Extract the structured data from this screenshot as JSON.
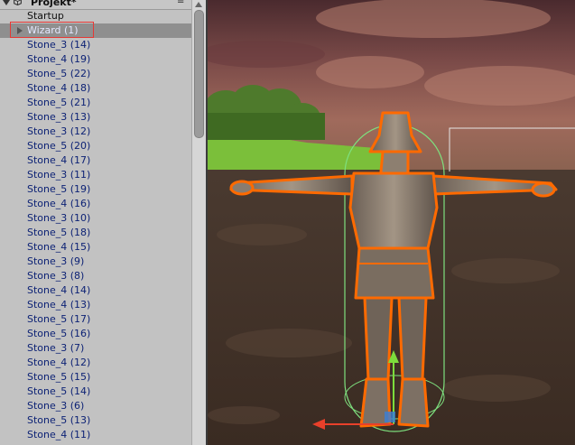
{
  "hierarchy": {
    "title": "Projekt*",
    "icons": {
      "collapse": "triangle-down-icon",
      "scene": "unity-scene-icon",
      "menu": "menu-icon"
    },
    "items": [
      {
        "label": "Startup",
        "style": "plain",
        "foldout": false
      },
      {
        "label": "Wizard (1)",
        "style": "selected",
        "foldout": true
      },
      {
        "label": "Stone_3 (14)"
      },
      {
        "label": "Stone_4 (19)"
      },
      {
        "label": "Stone_5 (22)"
      },
      {
        "label": "Stone_4 (18)"
      },
      {
        "label": "Stone_5 (21)"
      },
      {
        "label": "Stone_3 (13)"
      },
      {
        "label": "Stone_3 (12)"
      },
      {
        "label": "Stone_5 (20)"
      },
      {
        "label": "Stone_4 (17)"
      },
      {
        "label": "Stone_3 (11)"
      },
      {
        "label": "Stone_5 (19)"
      },
      {
        "label": "Stone_4 (16)"
      },
      {
        "label": "Stone_3 (10)"
      },
      {
        "label": "Stone_5 (18)"
      },
      {
        "label": "Stone_4 (15)"
      },
      {
        "label": "Stone_3 (9)"
      },
      {
        "label": "Stone_3 (8)"
      },
      {
        "label": "Stone_4 (14)"
      },
      {
        "label": "Stone_4 (13)"
      },
      {
        "label": "Stone_5 (17)"
      },
      {
        "label": "Stone_5 (16)"
      },
      {
        "label": "Stone_3 (7)"
      },
      {
        "label": "Stone_4 (12)"
      },
      {
        "label": "Stone_5 (15)"
      },
      {
        "label": "Stone_5 (14)"
      },
      {
        "label": "Stone_3 (6)"
      },
      {
        "label": "Stone_5 (13)"
      },
      {
        "label": "Stone_4 (11)"
      }
    ]
  },
  "colors": {
    "selection": "#8f8f8f",
    "prefab_text": "#0d2275",
    "outline": "#ff6a00",
    "collider": "#7ee07e",
    "gizmo_y": "#7ddc3c",
    "gizmo_x": "#e8402a",
    "annotation_box": "#e53935"
  },
  "scene": {
    "selected_object": "Wizard (1)"
  }
}
